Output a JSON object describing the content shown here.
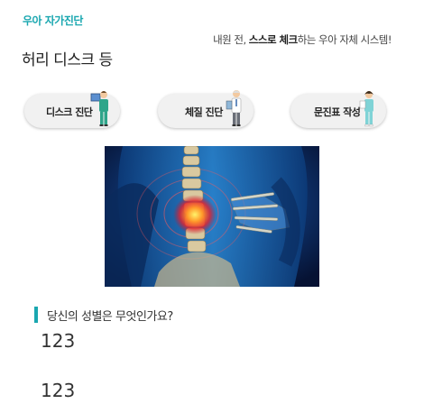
{
  "header": {
    "brand": "우아 자가진단",
    "title": "허리 디스크 등",
    "tagline_before": "내원 전, ",
    "tagline_bold1": "스스로 체크",
    "tagline_after": "하는 우아 자체 시스템!"
  },
  "menu": {
    "items": [
      {
        "label": "디스크 진단",
        "icon": "doctor-icon"
      },
      {
        "label": "체질 진단",
        "icon": "doctor-icon"
      },
      {
        "label": "문진표 작성",
        "icon": "nurse-icon"
      }
    ]
  },
  "hero": {
    "image": "spine-pain-illustration"
  },
  "question": {
    "text": "당신의 성별은 무엇인가요?",
    "options": [
      "123",
      "123"
    ]
  },
  "colors": {
    "accent": "#1aa7b0",
    "button_bg": "#f1f1f1"
  }
}
